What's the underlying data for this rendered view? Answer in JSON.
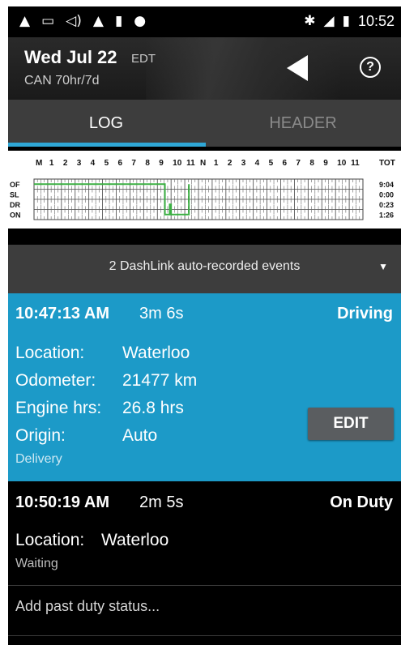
{
  "status_bar": {
    "icons": [
      "warning-icon",
      "image-icon",
      "vibrate-icon",
      "warning-icon",
      "torch-icon",
      "android-icon"
    ],
    "right_icons": [
      "bluetooth-icon",
      "signal-icon",
      "battery-icon"
    ],
    "time": "10:52"
  },
  "header": {
    "date": "Wed Jul 22",
    "timezone": "EDT",
    "cycle": "CAN 70hr/7d",
    "help_glyph": "?"
  },
  "tabs": [
    {
      "label": "LOG",
      "active": true
    },
    {
      "label": "HEADER",
      "active": false
    }
  ],
  "graph": {
    "hours": [
      "M",
      "1",
      "2",
      "3",
      "4",
      "5",
      "6",
      "7",
      "8",
      "9",
      "10",
      "11",
      "N",
      "1",
      "2",
      "3",
      "4",
      "5",
      "6",
      "7",
      "8",
      "9",
      "10",
      "11"
    ],
    "total_label": "TOT",
    "rows": [
      {
        "label": "OF",
        "total": "9:04"
      },
      {
        "label": "SL",
        "total": "0:00"
      },
      {
        "label": "DR",
        "total": "0:23"
      },
      {
        "label": "ON",
        "total": "1:26"
      }
    ],
    "line_color": "#3cb043"
  },
  "banner": {
    "text": "2 DashLink auto-recorded events",
    "arrow": "▼"
  },
  "events": [
    {
      "time": "10:47:13 AM",
      "duration": "3m 6s",
      "status": "Driving",
      "fields": [
        {
          "label": "Location:",
          "value": "Waterloo"
        },
        {
          "label": "Odometer:",
          "value": "21477 km"
        },
        {
          "label": "Engine hrs:",
          "value": "26.8 hrs"
        },
        {
          "label": "Origin:",
          "value": "Auto"
        }
      ],
      "note": "Delivery",
      "edit_label": "EDIT"
    },
    {
      "time": "10:50:19 AM",
      "duration": "2m 5s",
      "status": "On Duty",
      "location_label": "Location:",
      "location_value": "Waterloo",
      "note": "Waiting"
    }
  ],
  "add_past_label": "Add past duty status...",
  "colors": {
    "accent": "#1c9ac8",
    "tab_indicator": "#2fa7d6",
    "bar_gray": "#3d3d3d"
  }
}
